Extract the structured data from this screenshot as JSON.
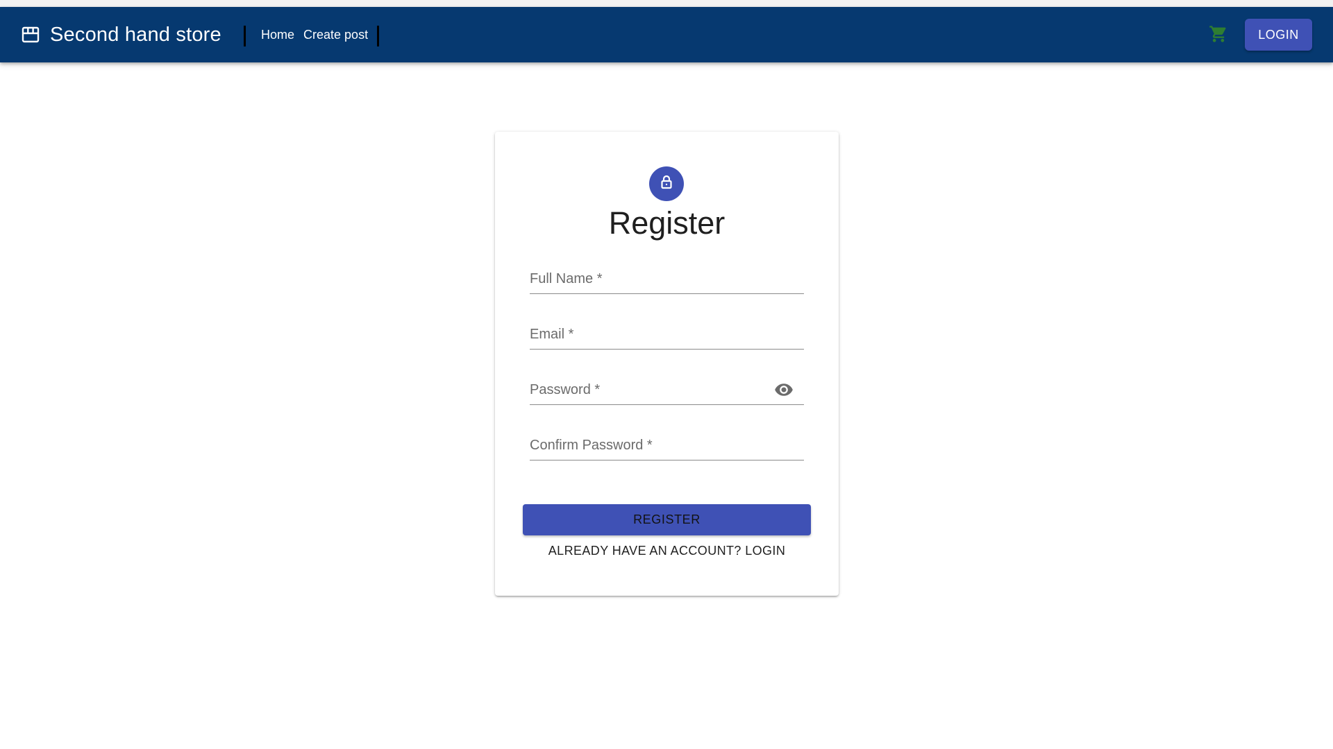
{
  "header": {
    "brand_title": "Second hand store",
    "brand_icon": "storefront-icon",
    "nav": [
      "Home",
      "Create post"
    ],
    "cart_icon": "shopping-cart-icon",
    "login_label": "LOGIN",
    "colors": {
      "appbar": "#063970",
      "accent": "#3f51b5",
      "cart": "#2e7d32"
    }
  },
  "form": {
    "icon": "lock-icon",
    "title": "Register",
    "fields": {
      "full_name": "Full Name *",
      "email": "Email *",
      "password": "Password *",
      "confirm_password": "Confirm Password *"
    },
    "password_toggle_icon": "eye-icon",
    "submit_label": "REGISTER",
    "login_link": "ALREADY HAVE AN ACCOUNT? LOGIN"
  }
}
